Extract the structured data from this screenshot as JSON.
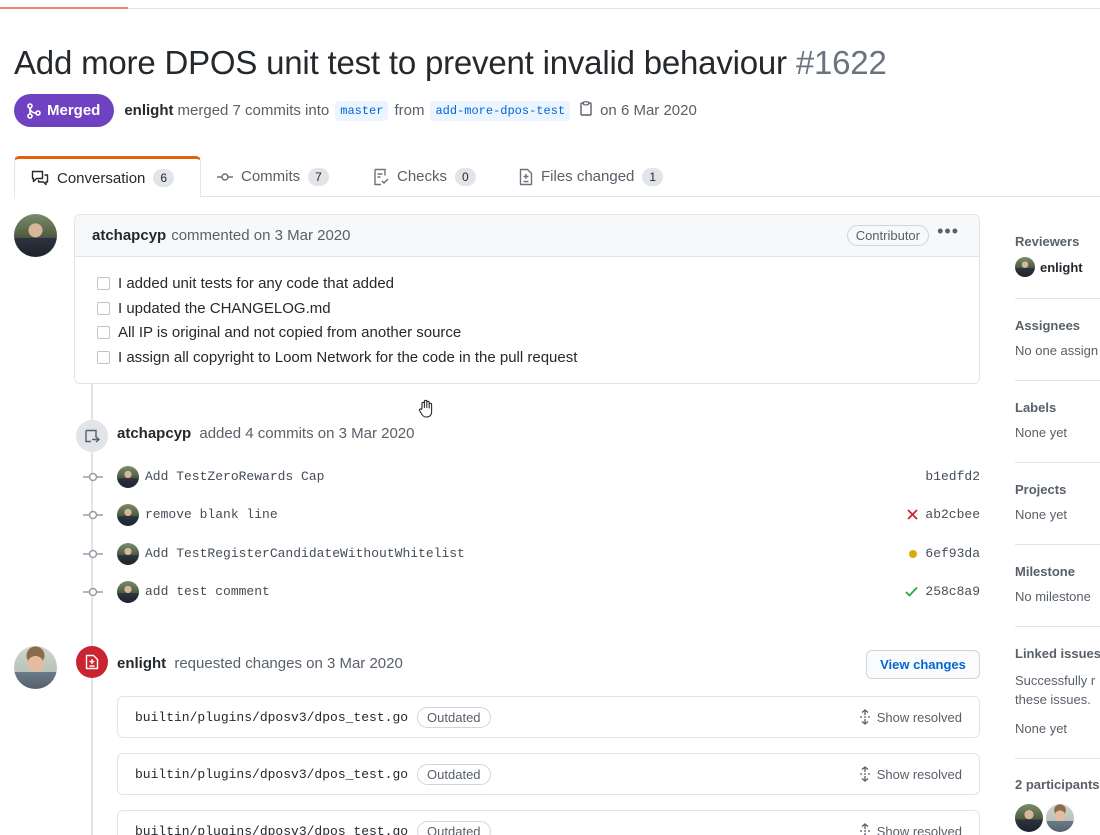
{
  "pr": {
    "title": "Add more DPOS unit test to prevent invalid behaviour",
    "number": "#1622",
    "state": "Merged",
    "author": "enlight",
    "merged_text": "merged 7 commits into",
    "base_branch": "master",
    "from_text": "from",
    "head_branch": "add-more-dpos-test",
    "date_text": "on 6 Mar 2020"
  },
  "tabs": [
    {
      "label": "Conversation",
      "count": "6"
    },
    {
      "label": "Commits",
      "count": "7"
    },
    {
      "label": "Checks",
      "count": "0"
    },
    {
      "label": "Files changed",
      "count": "1"
    }
  ],
  "comment": {
    "author": "atchapcyp",
    "action": "commented on 3 Mar 2020",
    "role": "Contributor",
    "checklist": [
      "I added unit tests for any code that added",
      "I updated the CHANGELOG.md",
      "All IP is original and not copied from another source",
      "I assign all copyright to Loom Network for the code in the pull request"
    ]
  },
  "push_event": {
    "author": "atchapcyp",
    "action": "added 4 commits on 3 Mar 2020",
    "commits": [
      {
        "message": "Add TestZeroRewards Cap",
        "sha": "b1edfd2",
        "status": "none"
      },
      {
        "message": "remove blank line",
        "sha": "ab2cbee",
        "status": "failure"
      },
      {
        "message": "Add TestRegisterCandidateWithoutWhitelist",
        "sha": "6ef93da",
        "status": "pending"
      },
      {
        "message": "add test comment",
        "sha": "258c8a9",
        "status": "success"
      }
    ]
  },
  "review": {
    "author": "enlight",
    "action": "requested changes on 3 Mar 2020",
    "view_changes_label": "View changes",
    "files": [
      {
        "path": "builtin/plugins/dposv3/dpos_test.go",
        "badge": "Outdated",
        "action": "Show resolved"
      },
      {
        "path": "builtin/plugins/dposv3/dpos_test.go",
        "badge": "Outdated",
        "action": "Show resolved"
      },
      {
        "path": "builtin/plugins/dposv3/dpos_test.go",
        "badge": "Outdated",
        "action": "Show resolved"
      }
    ]
  },
  "sidebar": {
    "reviewers": {
      "heading": "Reviewers",
      "value": "enlight"
    },
    "assignees": {
      "heading": "Assignees",
      "value": "No one assign"
    },
    "labels": {
      "heading": "Labels",
      "value": "None yet"
    },
    "projects": {
      "heading": "Projects",
      "value": "None yet"
    },
    "milestone": {
      "heading": "Milestone",
      "value": "No milestone"
    },
    "linked": {
      "heading": "Linked issues",
      "line1": "Successfully r",
      "line2": "these issues.",
      "value": "None yet"
    },
    "participants": {
      "heading": "2 participants"
    }
  },
  "colors": {
    "merged": "#6f42c1",
    "link": "#0366d6",
    "failure": "#cb2431",
    "pending": "#dbab09",
    "success": "#28a745"
  }
}
